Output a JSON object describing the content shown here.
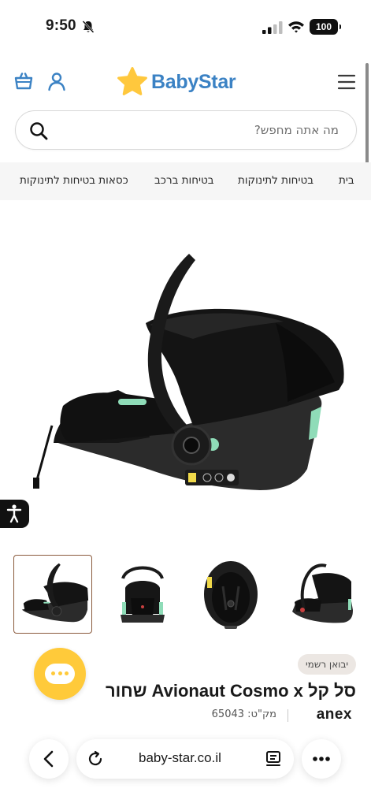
{
  "status_bar": {
    "time": "9:50",
    "battery": "100"
  },
  "header": {
    "logo_text": "BabyStar",
    "brand_color": "#3b82c4",
    "star_color": "#ffc83d"
  },
  "search": {
    "placeholder": "מה אתה מחפש?",
    "value": ""
  },
  "categories": [
    {
      "label": "בית"
    },
    {
      "label": "בטיחות לתינוקות"
    },
    {
      "label": "בטיחות ברכב"
    },
    {
      "label": "כסאות בטיחות לתינוקות"
    }
  ],
  "product": {
    "badge": "יבואן רשמי",
    "title": "סל קל Avionaut Cosmo x שחור",
    "brand": "anex",
    "sku_label": "מק\"ט:",
    "sku": "65043",
    "thumbnail_count": 4,
    "selected_thumbnail": 1
  },
  "browser": {
    "url": "baby-star.co.il"
  },
  "icons": {
    "cart": "shopping-basket-icon",
    "user": "user-icon",
    "menu": "hamburger-menu-icon",
    "search": "search-icon",
    "accessibility": "accessibility-icon",
    "chat": "chat-icon",
    "back": "chevron-left-icon",
    "reload": "reload-icon",
    "reader": "reader-mode-icon",
    "more": "more-icon"
  },
  "colors": {
    "chat_button": "#ffca3a",
    "accent_mint": "#8fdcb8"
  }
}
